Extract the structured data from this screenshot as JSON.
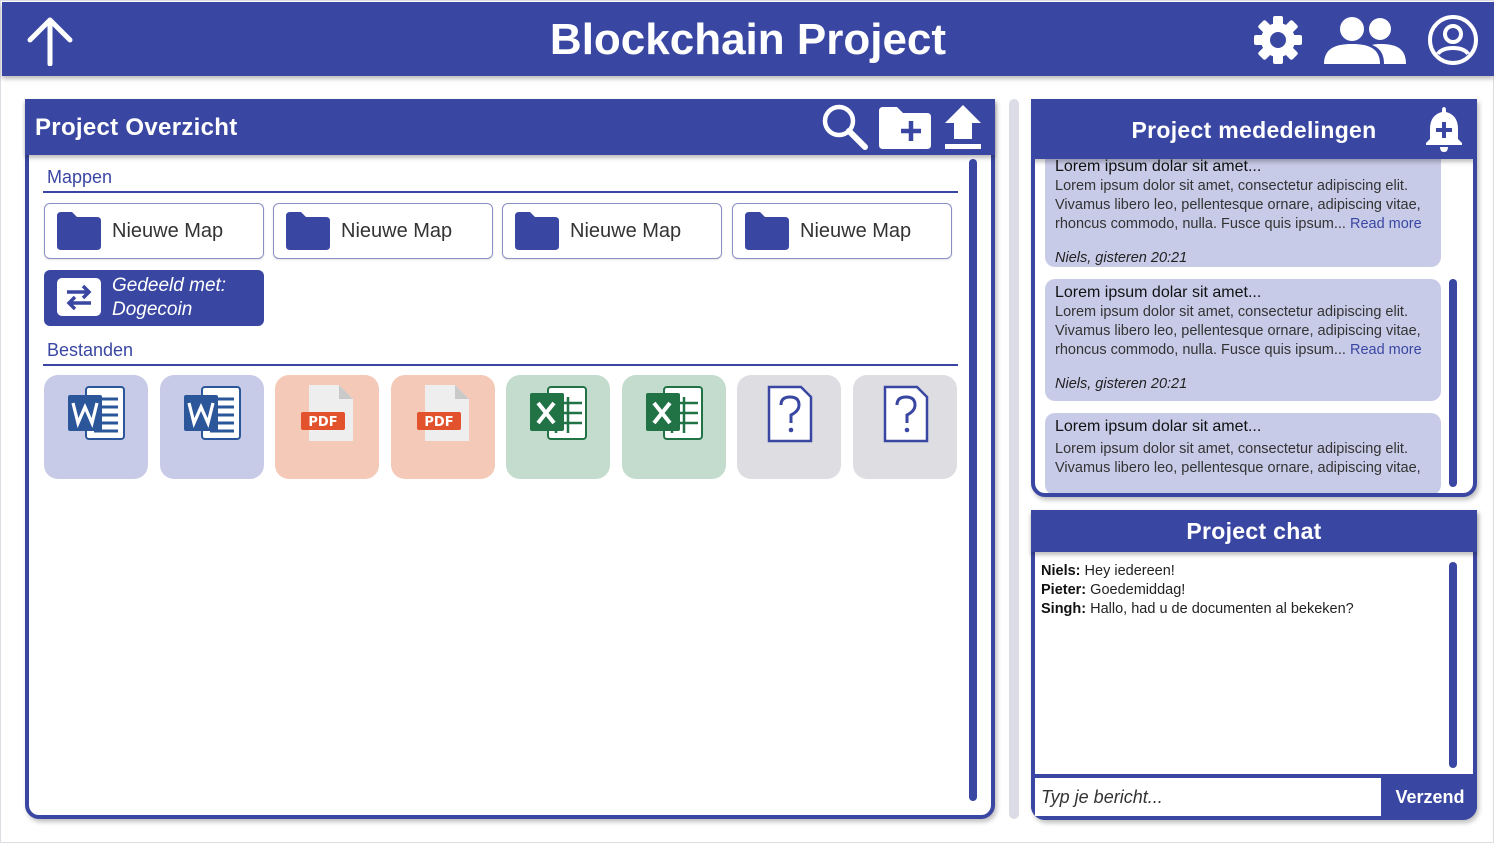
{
  "app": {
    "title": "Blockchain Project",
    "accent": "#3a47a2",
    "icons": [
      "arrow-up-icon",
      "settings-gear-icon",
      "people-icon",
      "account-circle-icon"
    ]
  },
  "overview": {
    "title": "Project Overzicht",
    "icons": [
      "search-icon",
      "new-folder-icon",
      "upload-icon"
    ],
    "folders_label": "Mappen",
    "folders": [
      {
        "label": "Nieuwe Map"
      },
      {
        "label": "Nieuwe Map"
      },
      {
        "label": "Nieuwe Map"
      },
      {
        "label": "Nieuwe Map"
      }
    ],
    "shared": {
      "line1": "Gedeeld met:",
      "line2": "Dogecoin"
    },
    "files_label": "Bestanden",
    "files": [
      {
        "type": "word",
        "color": "#c7cbe8"
      },
      {
        "type": "word",
        "color": "#c7cbe8"
      },
      {
        "type": "pdf",
        "color": "#f5c9b8"
      },
      {
        "type": "pdf",
        "color": "#f5c9b8"
      },
      {
        "type": "excel",
        "color": "#c4dccd"
      },
      {
        "type": "excel",
        "color": "#c4dccd"
      },
      {
        "type": "unknown",
        "color": "#dddde2"
      },
      {
        "type": "unknown",
        "color": "#dddde2"
      }
    ]
  },
  "announcements": {
    "title": "Project mededelingen",
    "icon": "add-notification-icon",
    "items": [
      {
        "title": "Lorem ipsum dolar sit amet...",
        "body": "Lorem ipsum dolor sit amet, consectetur adipiscing elit. Vivamus libero leo, pellentesque ornare, adipiscing vitae, rhoncus commodo, nulla. Fusce quis ipsum...",
        "more": "Read more",
        "meta": "Niels, gisteren 20:21"
      },
      {
        "title": "Lorem ipsum dolar sit amet...",
        "body": "Lorem ipsum dolor sit amet, consectetur adipiscing elit. Vivamus libero leo, pellentesque ornare, adipiscing vitae, rhoncus commodo, nulla. Fusce quis ipsum...",
        "more": "Read more",
        "meta": "Niels, gisteren 20:21"
      },
      {
        "title": "Lorem ipsum dolar sit amet...",
        "body": "Lorem ipsum dolor sit amet, consectetur adipiscing elit. Vivamus libero leo, pellentesque ornare, adipiscing vitae,"
      }
    ]
  },
  "chat": {
    "title": "Project chat",
    "messages": [
      {
        "author": "Niels:",
        "text": " Hey iedereen!"
      },
      {
        "author": "Pieter:",
        "text": " Goedemiddag!"
      },
      {
        "author": "Singh:",
        "text": " Hallo, had u de documenten al bekeken?"
      }
    ],
    "placeholder": "Typ je bericht...",
    "send": "Verzend"
  }
}
